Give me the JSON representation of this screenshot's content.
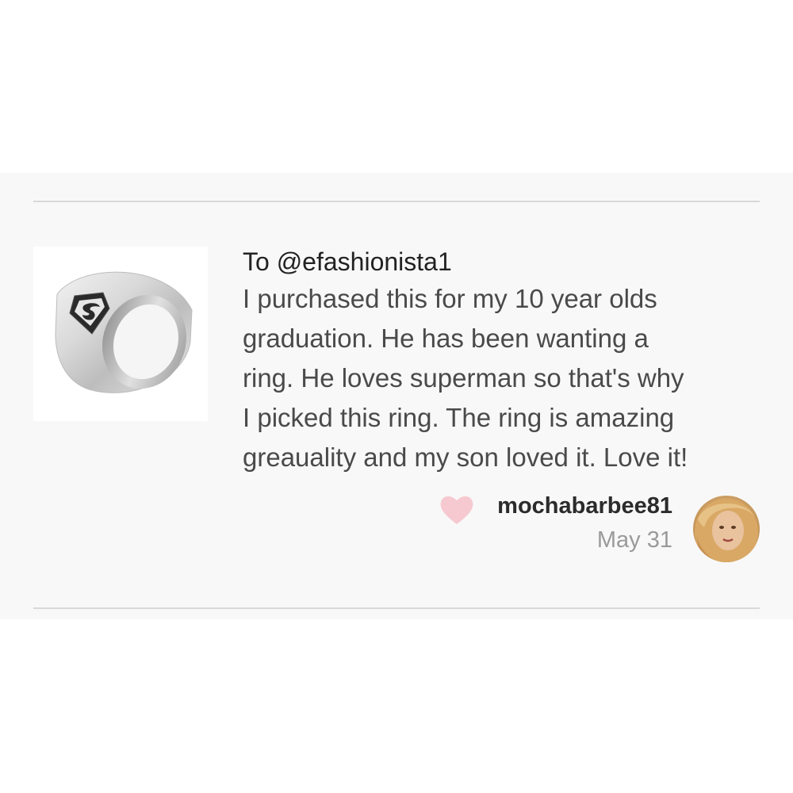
{
  "review": {
    "recipient": "To @efashionista1",
    "body_lines": [
      "I purchased this for my 10 year olds",
      "graduation. He has been wanting a",
      "ring. He loves superman so that's why",
      "I picked this ring. The ring is amazing",
      "greauality and my son loved it. Love it!"
    ],
    "username": "mochabarbee81",
    "date": "May 31"
  },
  "icons": {
    "like": "heart-icon",
    "product": "superman-ring-image",
    "user": "user-avatar"
  },
  "colors": {
    "heart": "#f6c9d0",
    "card_bg": "#f8f8f8",
    "divider": "#d8d8d8",
    "date_text": "#9a9a9a"
  }
}
